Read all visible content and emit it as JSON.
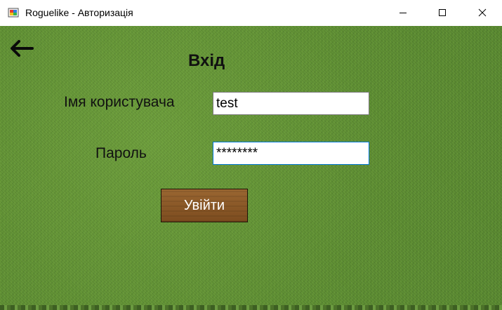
{
  "window": {
    "title": "Roguelike - Авторизація",
    "controls": {
      "minimize_icon": "minimize-icon",
      "maximize_icon": "maximize-icon",
      "close_icon": "close-icon"
    }
  },
  "form": {
    "back_icon": "arrow-left-icon",
    "heading": "Вхід",
    "username_label": "Імя користувача",
    "username_value": "test",
    "password_label": "Пароль",
    "password_value": "********",
    "login_button": "Увійти"
  },
  "colors": {
    "background": "#5d8f33",
    "button": "#8a5826",
    "focus_border": "#0078d7"
  }
}
